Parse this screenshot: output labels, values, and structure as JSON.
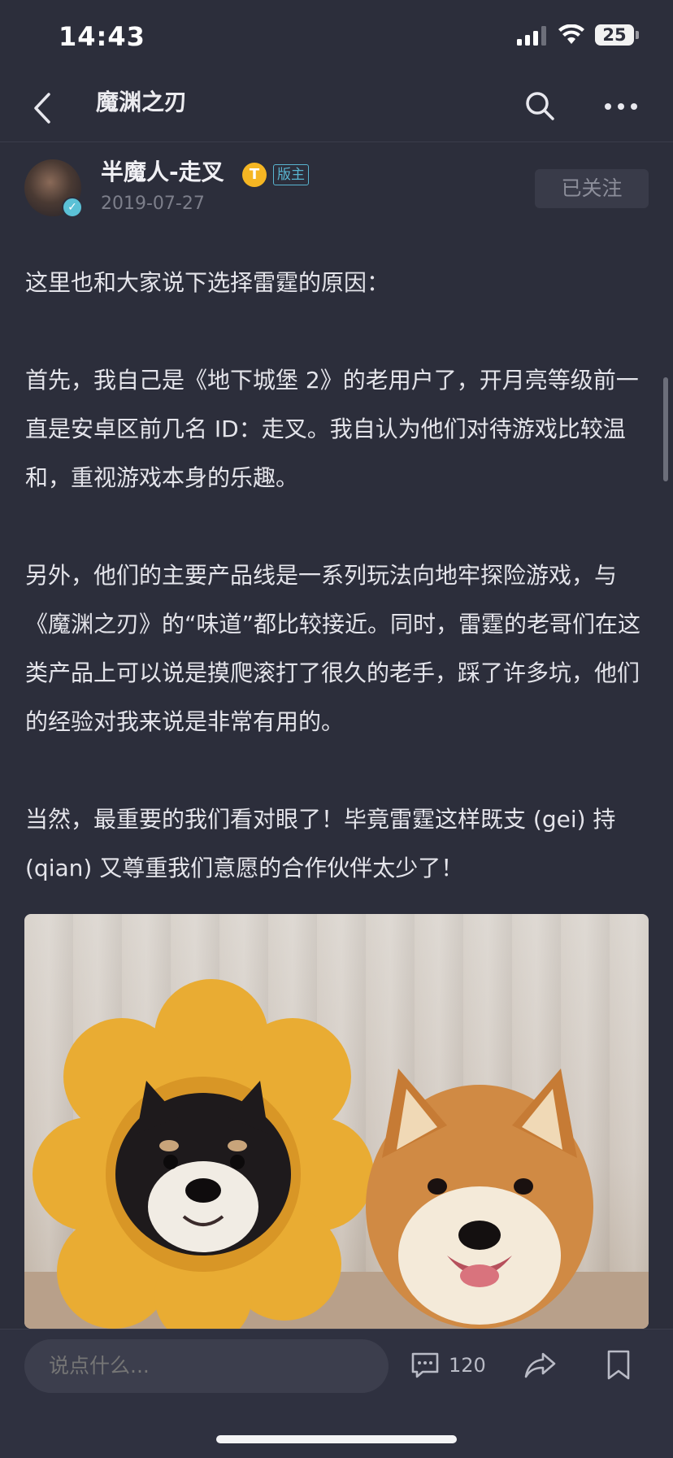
{
  "status_bar": {
    "time": "14:43",
    "battery": "25"
  },
  "nav": {
    "title": "魔渊之刃"
  },
  "author": {
    "name": "半魔人-走叉",
    "rank_badge": "T",
    "role_badge": "版主",
    "date": "2019-07-27",
    "follow_label": "已关注"
  },
  "post": {
    "paragraphs": [
      "这里也和大家说下选择雷霆的原因：",
      "首先，我自己是《地下城堡 2》的老用户了，开月亮等级前一直是安卓区前几名 ID：走叉。我自认为他们对待游戏比较温和，重视游戏本身的乐趣。",
      "另外，他们的主要产品线是一系列玩法向地牢探险游戏，与《魔渊之刃》的“味道”都比较接近。同时，雷霆的老哥们在这类产品上可以说是摸爬滚打了很久的老手，踩了许多坑，他们的经验对我来说是非常有用的。",
      "当然，最重要的我们看对眼了！毕竟雷霆这样既支 (gei) 持 (qian) 又尊重我们意愿的合作伙伴太少了！"
    ]
  },
  "bottom_bar": {
    "comment_placeholder": "说点什么...",
    "comment_count": "120"
  }
}
